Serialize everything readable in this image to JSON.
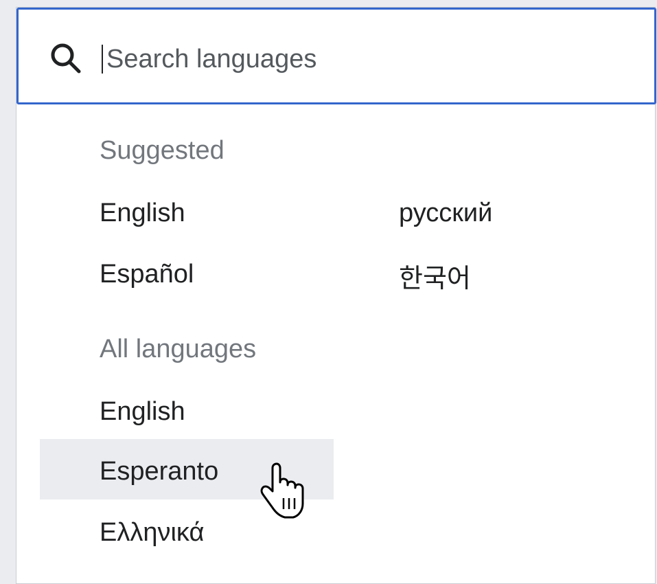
{
  "search": {
    "placeholder": "Search languages"
  },
  "suggested": {
    "heading": "Suggested",
    "items": [
      "English",
      "Español",
      "русский",
      "한국어"
    ]
  },
  "all_languages": {
    "heading": "All languages",
    "items": [
      "English",
      "Esperanto",
      "Ελληνικά"
    ]
  },
  "colors": {
    "accent": "#3366cc",
    "hover_background": "#eaecf0",
    "heading_text": "#72777d",
    "body_text": "#202122"
  },
  "icons": [
    "search-icon",
    "hand-pointer-cursor-icon"
  ]
}
